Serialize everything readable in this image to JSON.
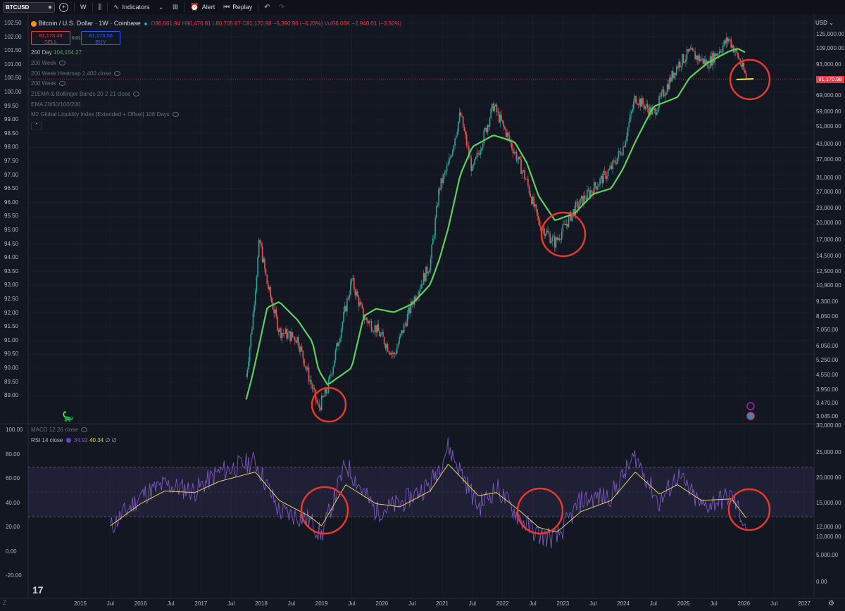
{
  "toolbar": {
    "symbol": "BTCUSD",
    "interval": "W",
    "indicators_label": "Indicators",
    "alert_label": "Alert",
    "replay_label": "Replay"
  },
  "legend": {
    "title": "Bitcoin / U.S. Dollar · 1W · Coinbase",
    "o_label": "O",
    "o_value": "86,561.94",
    "h_label": "H",
    "h_value": "90,476.81",
    "l_label": "L",
    "l_value": "80,705.67",
    "c_label": "C",
    "c_value": "81,170.98",
    "change": "−5,390.96 (−6.23%)",
    "vol_label": "Vol",
    "vol_value": "56.06K",
    "vol_change": "−2,940.01 (−3.50%)",
    "sell_price": "81,173.49",
    "sell_label": "SELL",
    "spread": "0.01",
    "buy_price": "81,173.50",
    "buy_label": "BUY"
  },
  "indicators": [
    {
      "name": "200 Day",
      "value": "104,164.27",
      "color": "#4caf50"
    },
    {
      "name": "200 Week"
    },
    {
      "name": "200 Week Heatmap 1,400 close"
    },
    {
      "name": "200 Week"
    },
    {
      "name": "21EMA & Bollinger Bands 20 2 21 close"
    },
    {
      "name": "EMA 20/50/100/200"
    },
    {
      "name": "M2 Global Liquidity Index [Extended + Offset] 108 Days"
    }
  ],
  "lower_pane": {
    "macd": "MACD 12 26 close",
    "rsi_label": "RSI 14 close",
    "rsi_value": "34.92",
    "rsi_ma": "40.34",
    "rsi_nan1": "∅",
    "rsi_nan2": "∅"
  },
  "axes": {
    "currency": "USD",
    "last_price": "81,170.98",
    "left_top": [
      "102.50",
      "102.00",
      "101.50",
      "101.00",
      "100.50",
      "100.00",
      "99.50",
      "99.00",
      "98.50",
      "98.00",
      "97.50",
      "97.00",
      "96.50",
      "96.00",
      "95.50",
      "95.00",
      "94.50",
      "94.00",
      "93.50",
      "93.00",
      "92.50",
      "92.00",
      "91.50",
      "91.00",
      "90.50",
      "90.00",
      "89.50",
      "89.00"
    ],
    "left_bottom": [
      "100.00",
      "80.00",
      "60.00",
      "40.00",
      "20.00",
      "0.00",
      "-20.00"
    ],
    "right_top": [
      "125,000.00",
      "109,000.00",
      "93,000.00",
      "69,000.00",
      "59,000.00",
      "51,000.00",
      "43,000.00",
      "37,000.00",
      "31,000.00",
      "27,000.00",
      "23,000.00",
      "20,000.00",
      "17,000.00",
      "14,500.00",
      "12,500.00",
      "10,900.00",
      "9,300.00",
      "8,050.00",
      "7,050.00",
      "6,050.00",
      "5,250.00",
      "4,550.00",
      "3,950.00",
      "3,470.00",
      "3,045.00"
    ],
    "right_bottom": [
      "30,000.00",
      "25,000.00",
      "20,000.00",
      "15,000.00",
      "12,000.00",
      "10,000.00",
      "5,000.00",
      "0.00"
    ],
    "time": [
      "2015",
      "Jul",
      "2016",
      "Jul",
      "2017",
      "Jul",
      "2018",
      "Jul",
      "2019",
      "Jul",
      "2020",
      "Jul",
      "2021",
      "Jul",
      "2022",
      "Jul",
      "2023",
      "Jul",
      "2024",
      "Jul",
      "2025",
      "Jul",
      "2026",
      "Jul",
      "2027"
    ]
  },
  "colors": {
    "up": "#26a69a",
    "down": "#ef5350",
    "ma200": "#5cd15c",
    "rsi": "#7e57c2",
    "rsi_ma": "#e6d35a",
    "circle": "#e8392c",
    "support": "#f2e64c"
  },
  "chart_data": [
    {
      "type": "line",
      "title": "Bitcoin / U.S. Dollar · 1W · Coinbase",
      "scale": "log",
      "x": [
        2017.75,
        2017.85,
        2017.97,
        2018.1,
        2018.3,
        2018.6,
        2018.85,
        2018.95,
        2019.1,
        2019.5,
        2019.7,
        2019.9,
        2020.2,
        2020.5,
        2020.8,
        2020.95,
        2021.1,
        2021.3,
        2021.5,
        2021.85,
        2022.2,
        2022.4,
        2022.6,
        2022.87,
        2023.2,
        2023.5,
        2023.8,
        2024.0,
        2024.2,
        2024.5,
        2024.9,
        2025.1,
        2025.4,
        2025.75,
        2025.9,
        2026.05
      ],
      "series": [
        {
          "values": [
            4500,
            7500,
            17000,
            11000,
            7000,
            6500,
            4000,
            3300,
            4000,
            11500,
            8000,
            7200,
            5500,
            9200,
            13500,
            28000,
            35000,
            58000,
            33000,
            63000,
            40000,
            30000,
            20000,
            16500,
            23000,
            28000,
            34000,
            42000,
            68000,
            58000,
            93000,
            105000,
            94000,
            120000,
            101000,
            81170
          ]
        },
        {
          "name": "200 Day",
          "values": [
            3600,
            4500,
            6200,
            8800,
            9300,
            7800,
            6300,
            4800,
            4150,
            4900,
            8100,
            8700,
            8400,
            9100,
            11000,
            14000,
            19000,
            32000,
            42000,
            47000,
            44000,
            36000,
            26000,
            20500,
            22000,
            26500,
            28000,
            34000,
            44000,
            62000,
            68000,
            82000,
            95000,
            106000,
            109000,
            104164
          ]
        }
      ]
    },
    {
      "type": "line",
      "title": "RSI 14 close",
      "ylim": [
        -25,
        100
      ],
      "x": [
        2015.5,
        2016.0,
        2016.4,
        2016.9,
        2017.3,
        2017.9,
        2018.3,
        2018.8,
        2019.0,
        2019.4,
        2019.9,
        2020.3,
        2020.8,
        2021.1,
        2021.6,
        2021.9,
        2022.3,
        2022.6,
        2022.9,
        2023.3,
        2023.8,
        2024.2,
        2024.6,
        2024.9,
        2025.3,
        2025.8,
        2026.05
      ],
      "series": [
        {
          "name": "RSI",
          "values": [
            35,
            55,
            62,
            58,
            70,
            77,
            45,
            40,
            30,
            75,
            45,
            50,
            62,
            86,
            48,
            60,
            40,
            30,
            28,
            52,
            55,
            80,
            50,
            68,
            48,
            55,
            34.92
          ]
        },
        {
          "name": "RSI MA",
          "values": [
            36,
            50,
            58,
            57,
            64,
            70,
            52,
            42,
            36,
            62,
            50,
            48,
            58,
            75,
            55,
            57,
            45,
            35,
            32,
            45,
            52,
            70,
            56,
            62,
            52,
            53,
            40.34
          ]
        }
      ]
    }
  ]
}
